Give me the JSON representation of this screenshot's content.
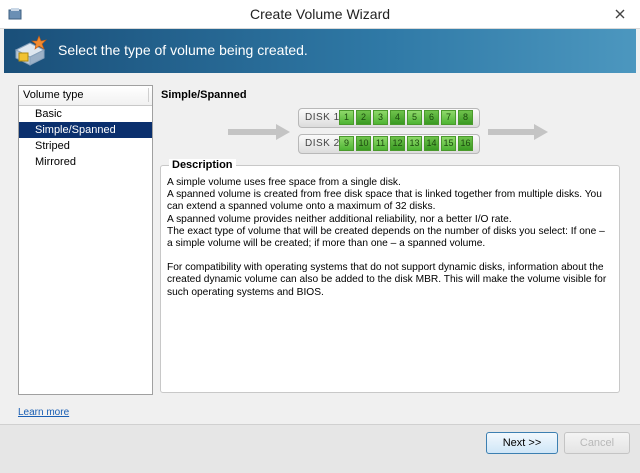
{
  "window": {
    "title": "Create Volume Wizard"
  },
  "banner": {
    "text": "Select the type of volume being created."
  },
  "volume_type": {
    "header": "Volume type",
    "items": [
      {
        "label": "Basic",
        "selected": false
      },
      {
        "label": "Simple/Spanned",
        "selected": true
      },
      {
        "label": "Striped",
        "selected": false
      },
      {
        "label": "Mirrored",
        "selected": false
      }
    ]
  },
  "diagram": {
    "title": "Simple/Spanned",
    "disk1": {
      "label": "DISK 1",
      "cells": [
        "1",
        "2",
        "3",
        "4",
        "5",
        "6",
        "7",
        "8"
      ]
    },
    "disk2": {
      "label": "DISK 2",
      "cells": [
        "9",
        "10",
        "11",
        "12",
        "13",
        "14",
        "15",
        "16"
      ]
    }
  },
  "description": {
    "title": "Description",
    "lines": [
      "A simple volume uses free space from a single disk.",
      "A spanned volume is created from free disk space that is linked together from multiple disks. You can extend a spanned volume onto a maximum of 32 disks.",
      "A spanned volume provides neither additional reliability, nor a better I/O rate.",
      "The exact type of volume that will be created depends on the number of disks you select: If one – a simple volume will be created; if more than one – a spanned volume."
    ],
    "note": "For compatibility with operating systems that do not support dynamic disks, information about the created dynamic volume can also be added to the disk MBR. This will make the volume visible for such operating systems and BIOS."
  },
  "footer": {
    "learn_more": "Learn more",
    "next_label": "Next >>",
    "cancel_label": "Cancel"
  },
  "colors": {
    "banner": "#1a4f79",
    "selection": "#0a2f6d",
    "disk_cell": "#4fb534",
    "link": "#1a5fb4"
  }
}
